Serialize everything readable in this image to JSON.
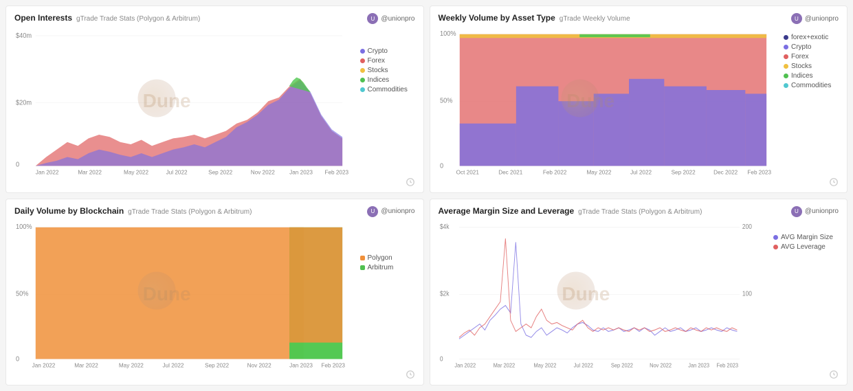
{
  "panels": [
    {
      "id": "open-interests",
      "title": "Open Interests",
      "subtitle": "gTrade Trade Stats (Polygon & Arbitrum)",
      "author": "@unionpro",
      "legend": [
        {
          "label": "Crypto",
          "color": "#7b6fe2"
        },
        {
          "label": "Forex",
          "color": "#e06060"
        },
        {
          "label": "Stocks",
          "color": "#f0c040"
        },
        {
          "label": "Indices",
          "color": "#50c050"
        },
        {
          "label": "Commodities",
          "color": "#50c8d0"
        }
      ],
      "yLabels": [
        "$40m",
        "$20m",
        "0"
      ],
      "xLabels": [
        "Jan 2022",
        "Mar 2022",
        "May 2022",
        "Jul 2022",
        "Sep 2022",
        "Nov 2022",
        "Jan 2023",
        "Feb 2023"
      ]
    },
    {
      "id": "weekly-volume",
      "title": "Weekly Volume by Asset Type",
      "subtitle": "gTrade Weekly Volume",
      "author": "@unionpro",
      "legend": [
        {
          "label": "forex+exotic",
          "color": "#3a3a8c"
        },
        {
          "label": "Crypto",
          "color": "#7b6fe2"
        },
        {
          "label": "Forex",
          "color": "#e06060"
        },
        {
          "label": "Stocks",
          "color": "#f0c040"
        },
        {
          "label": "Indices",
          "color": "#50c050"
        },
        {
          "label": "Commodities",
          "color": "#50c8d0"
        }
      ],
      "yLabels": [
        "100%",
        "50%",
        "0"
      ],
      "xLabels": [
        "Oct 2021",
        "Dec 2021",
        "Feb 2022",
        "May 2022",
        "Jul 2022",
        "Sep 2022",
        "Dec 2022",
        "Feb 2023"
      ]
    },
    {
      "id": "daily-volume-blockchain",
      "title": "Daily Volume by Blockchain",
      "subtitle": "gTrade Trade Stats (Polygon & Arbitrum)",
      "author": "@unionpro",
      "legend": [
        {
          "label": "Polygon",
          "color": "#f0903a"
        },
        {
          "label": "Arbitrum",
          "color": "#50c050"
        }
      ],
      "yLabels": [
        "100%",
        "50%",
        "0"
      ],
      "xLabels": [
        "Jan 2022",
        "Mar 2022",
        "May 2022",
        "Jul 2022",
        "Sep 2022",
        "Nov 2022",
        "Jan 2023",
        "Feb 2023"
      ]
    },
    {
      "id": "avg-margin-leverage",
      "title": "Average Margin Size and Leverage",
      "subtitle": "gTrade Trade Stats (Polygon & Arbitrum)",
      "author": "@unionpro",
      "legend": [
        {
          "label": "AVG Margin Size",
          "color": "#7b6fe2"
        },
        {
          "label": "AVG Leverage",
          "color": "#e06060"
        }
      ],
      "yLabelsLeft": [
        "$4k",
        "$2k",
        "0"
      ],
      "yLabelsRight": [
        "200",
        "100",
        ""
      ],
      "xLabels": [
        "Jan 2022",
        "Mar 2022",
        "May 2022",
        "Jul 2022",
        "Sep 2022",
        "Nov 2022",
        "Jan 2023",
        "Feb 2023"
      ]
    }
  ],
  "watermark": "Dune"
}
